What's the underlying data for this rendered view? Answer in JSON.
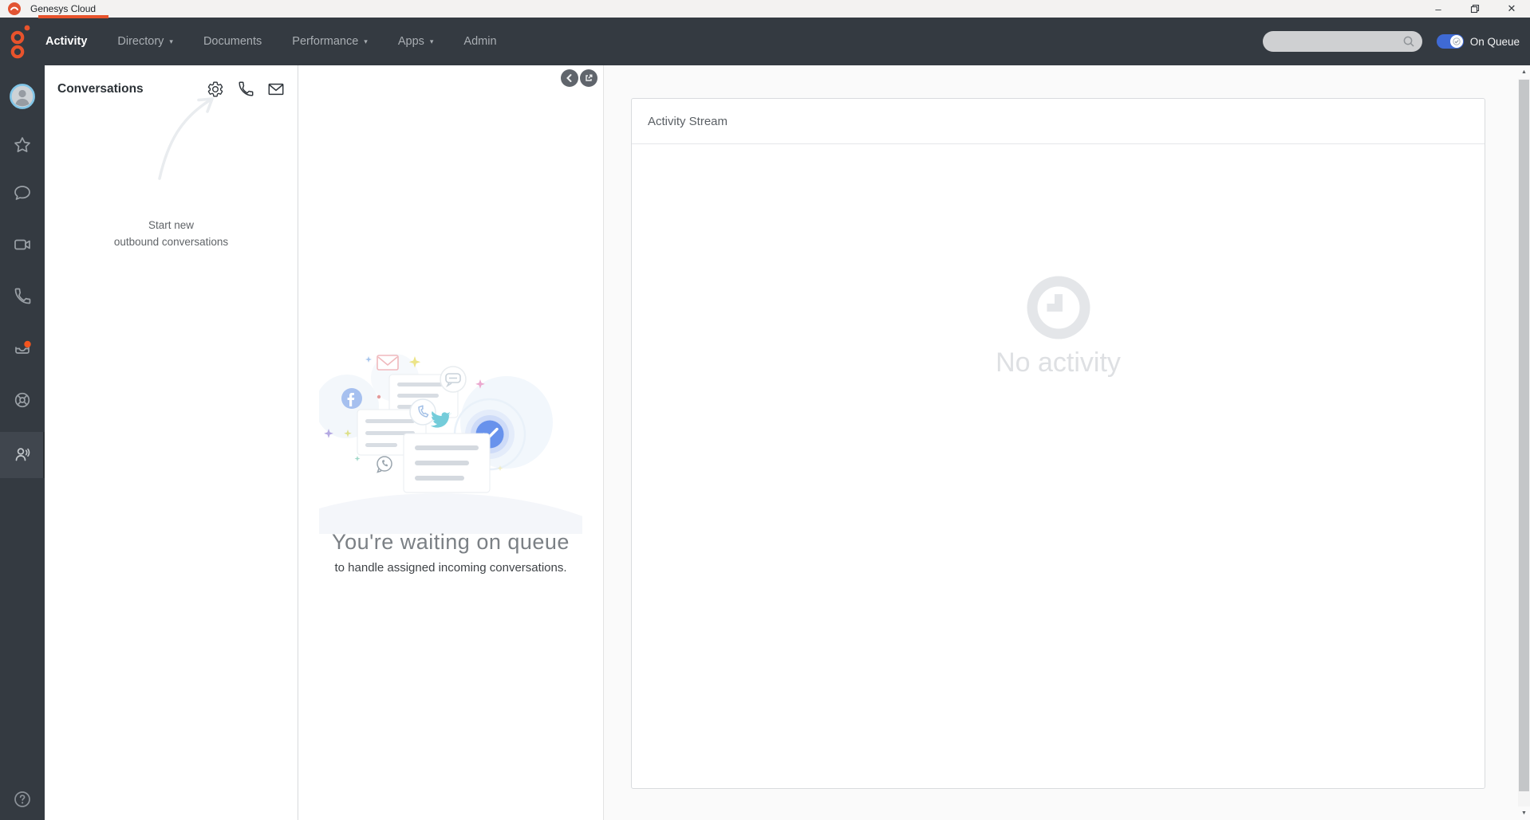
{
  "window": {
    "title": "Genesys Cloud",
    "controls": {
      "minimize": "–",
      "close": "✕"
    }
  },
  "nav": {
    "items": [
      {
        "label": "Activity",
        "active": true,
        "dropdown": false
      },
      {
        "label": "Directory",
        "active": false,
        "dropdown": true
      },
      {
        "label": "Documents",
        "active": false,
        "dropdown": false
      },
      {
        "label": "Performance",
        "active": false,
        "dropdown": true
      },
      {
        "label": "Apps",
        "active": false,
        "dropdown": true
      },
      {
        "label": "Admin",
        "active": false,
        "dropdown": false
      }
    ],
    "caret": "▾",
    "search": {
      "value": "",
      "placeholder": ""
    },
    "on_queue_label": "On Queue"
  },
  "sidebar": {
    "icons": [
      "profile-avatar",
      "favorites-star-icon",
      "chat-icon",
      "video-icon",
      "phone-icon",
      "inbox-icon-with-badge",
      "performance-ring-icon",
      "agents-icon-selected",
      "help-icon"
    ]
  },
  "conversations": {
    "title": "Conversations",
    "toolbar_icons": [
      "settings-gear-icon",
      "new-call-phone-icon",
      "new-email-envelope-icon"
    ],
    "hint_line1": "Start new",
    "hint_line2": "outbound conversations"
  },
  "queue_panel": {
    "title": "You're waiting on queue",
    "subtitle": "to handle assigned incoming conversations."
  },
  "activity_stream": {
    "title": "Activity Stream",
    "empty_text": "No activity"
  },
  "scrollbar": {
    "up": "▲",
    "down": "▼"
  },
  "colors": {
    "accent_orange": "#e8532c",
    "nav_background": "#343a41",
    "on_queue_blue": "#3f6ad4",
    "check_circle_blue": "#6892ec"
  }
}
